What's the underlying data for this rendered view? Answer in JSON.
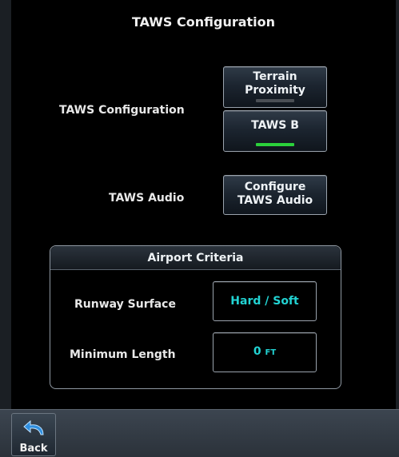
{
  "header": {
    "title": "TAWS Configuration"
  },
  "taws_configuration": {
    "label": "TAWS Configuration",
    "options": [
      {
        "label": "Terrain Proximity",
        "line1": "Terrain",
        "line2": "Proximity",
        "selected": false
      },
      {
        "label": "TAWS B",
        "selected": true
      }
    ]
  },
  "taws_audio": {
    "label": "TAWS Audio",
    "button_line1": "Configure",
    "button_line2": "TAWS Audio"
  },
  "airport_criteria": {
    "title": "Airport Criteria",
    "runway_surface": {
      "label": "Runway Surface",
      "value": "Hard / Soft"
    },
    "minimum_length": {
      "label": "Minimum Length",
      "value": "0",
      "unit": "FT"
    }
  },
  "bottom_bar": {
    "back_label": "Back"
  },
  "colors": {
    "accent_cyan": "#22d3d3",
    "indicator_on": "#2bd13b",
    "indicator_off": "#4a4f55"
  }
}
